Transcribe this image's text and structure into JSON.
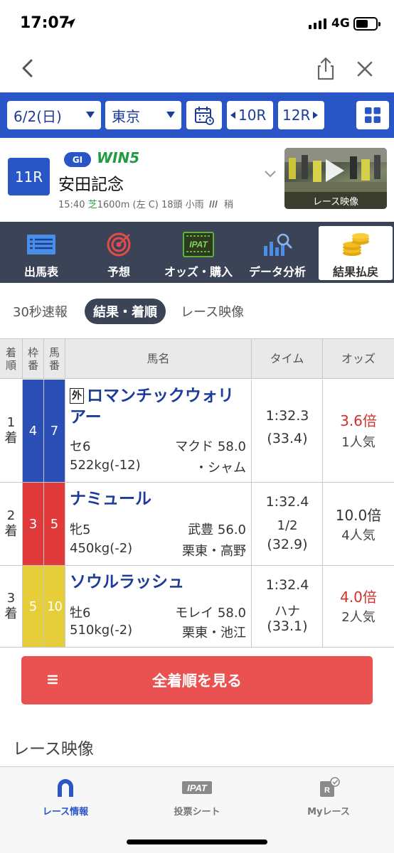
{
  "status": {
    "time": "17:07",
    "network": "4G"
  },
  "selector": {
    "date": "6/2(日)",
    "place": "東京",
    "prev_race": "10R",
    "next_race": "12R"
  },
  "race": {
    "number": "11R",
    "grade": "GI",
    "win5": "WIN5",
    "name": "安田記念",
    "time": "15:40",
    "surface": "芝",
    "info": "1600m (左 C) 18頭 小雨",
    "going": "稍",
    "video_label": "レース映像"
  },
  "tabs": [
    {
      "label": "出馬表",
      "icon": "entries-icon"
    },
    {
      "label": "予想",
      "icon": "target-icon"
    },
    {
      "label": "オッズ・購入",
      "icon": "ipat-icon"
    },
    {
      "label": "データ分析",
      "icon": "chart-search-icon"
    },
    {
      "label": "結果払戻",
      "icon": "coins-icon"
    }
  ],
  "subtabs": [
    "30秒速報",
    "結果・着順",
    "レース映像"
  ],
  "table": {
    "headers": {
      "rank": "着順",
      "waku": "枠番",
      "umaban": "馬番",
      "horse": "馬名",
      "time": "タイム",
      "odds": "オッズ"
    },
    "rows": [
      {
        "rank": "1着",
        "waku": "4",
        "umaban": "7",
        "foreign": "外",
        "name": "ロマンチックウォリアー",
        "sexage": "セ6",
        "jockey": "マクド",
        "weight": "58.0",
        "body": "522kg(-12)",
        "trainer": "・シャム",
        "time": "1:32.3",
        "margin": "",
        "last3f": "(33.4)",
        "odds": "3.6倍",
        "popularity": "1人気",
        "waku_color": "#2c4fb6",
        "odds_color": "#d0312d"
      },
      {
        "rank": "2着",
        "waku": "3",
        "umaban": "5",
        "foreign": "",
        "name": "ナミュール",
        "sexage": "牝5",
        "jockey": "武豊",
        "weight": "56.0",
        "body": "450kg(-2)",
        "trainer": "栗東・高野",
        "time": "1:32.4",
        "margin": "1/2",
        "last3f": "(32.9)",
        "odds": "10.0倍",
        "popularity": "4人気",
        "waku_color": "#e03a3a",
        "odds_color": "#333333"
      },
      {
        "rank": "3着",
        "waku": "5",
        "umaban": "10",
        "foreign": "",
        "name": "ソウルラッシュ",
        "sexage": "牡6",
        "jockey": "モレイ",
        "weight": "58.0",
        "body": "510kg(-2)",
        "trainer": "栗東・池江",
        "time": "1:32.4",
        "margin": "ハナ",
        "last3f": "(33.1)",
        "odds": "4.0倍",
        "popularity": "2人気",
        "waku_color": "#e6cd3a",
        "odds_color": "#d0312d"
      }
    ]
  },
  "all_results_button": "全着順を見る",
  "section_title": "レース映像",
  "bottom_nav": [
    {
      "label": "レース情報",
      "icon": "horseshoe-icon"
    },
    {
      "label": "投票シート",
      "icon": "ipat-icon",
      "icon_text": "IPAT"
    },
    {
      "label": "Myレース",
      "icon": "my-race-icon",
      "icon_text": "R"
    }
  ],
  "colors": {
    "primary": "#2a55c6",
    "nav_dark": "#3a4456",
    "button_red": "#ea5151",
    "win5_green": "#1e9c3e",
    "link_blue": "#1c3c99"
  }
}
